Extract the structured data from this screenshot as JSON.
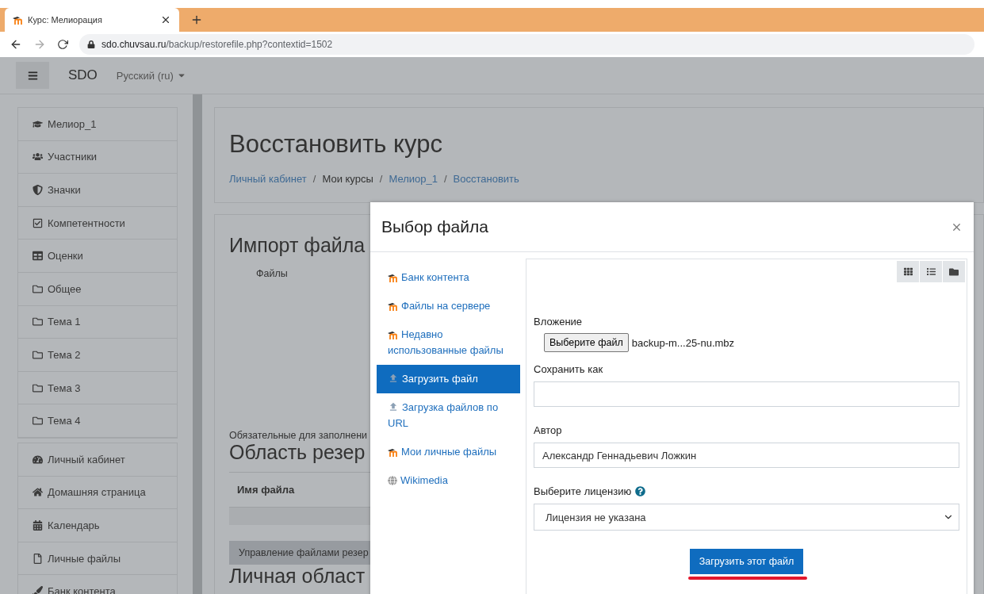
{
  "browser": {
    "tab_title": "Курс: Мелиорация",
    "url_host": "sdo.chuvsau.ru",
    "url_path": "/backup/restorefile.php?contextid=1502"
  },
  "navbar": {
    "brand": "SDO",
    "language": "Русский (ru)"
  },
  "sidebar": {
    "groups": [
      {
        "items": [
          {
            "label": "Мелиор_1"
          },
          {
            "label": "Участники"
          },
          {
            "label": "Значки"
          },
          {
            "label": "Компетентности"
          },
          {
            "label": "Оценки"
          },
          {
            "label": "Общее"
          },
          {
            "label": "Тема 1"
          },
          {
            "label": "Тема 2"
          },
          {
            "label": "Тема 3"
          },
          {
            "label": "Тема 4"
          }
        ]
      },
      {
        "items": [
          {
            "label": "Личный кабинет"
          },
          {
            "label": "Домашняя страница"
          },
          {
            "label": "Календарь"
          },
          {
            "label": "Личные файлы"
          },
          {
            "label": "Банк контента"
          }
        ]
      }
    ]
  },
  "page": {
    "title": "Восстановить курс",
    "breadcrumbs": [
      {
        "label": "Личный кабинет",
        "link": true
      },
      {
        "separator": "/",
        "label": "Мои курсы",
        "link": false
      },
      {
        "separator": "/",
        "label": "Мелиор_1",
        "link": true
      },
      {
        "separator": "/",
        "label": "Восстановить",
        "link": true
      }
    ],
    "import_title": "Импорт файла",
    "files_label": "Файлы",
    "required_note": "Обязательные для заполнени",
    "backup_area_title": "Область резер",
    "column_1": "Имя файла",
    "manage_button": "Управление файлами резер",
    "personal_area_title": "Личная област"
  },
  "dialog": {
    "title": "Выбор файла",
    "repositories": [
      {
        "label": "Банк контента",
        "kind": "moodle",
        "selected": false
      },
      {
        "label": "Файлы на сервере",
        "kind": "moodle",
        "selected": false
      },
      {
        "label": "Недавно использованные файлы",
        "kind": "moodle",
        "selected": false
      },
      {
        "label": "Загрузить файл",
        "kind": "upload",
        "selected": true
      },
      {
        "label": "Загрузка файлов по URL",
        "kind": "upload",
        "selected": false
      },
      {
        "label": "Мои личные файлы",
        "kind": "moodle",
        "selected": false
      },
      {
        "label": "Wikimedia",
        "kind": "wiki",
        "selected": false
      }
    ],
    "attachment_label": "Вложение",
    "choose_button": "Выберите файл",
    "chosen_file": "backup-m...25-nu.mbz",
    "save_as_label": "Сохранить как",
    "author_label": "Автор",
    "author_value": "Александр Геннадьевич Ложкин",
    "license_label": "Выберите лицензию",
    "license_value": "Лицензия не указана",
    "upload_button": "Загрузить этот файл"
  }
}
